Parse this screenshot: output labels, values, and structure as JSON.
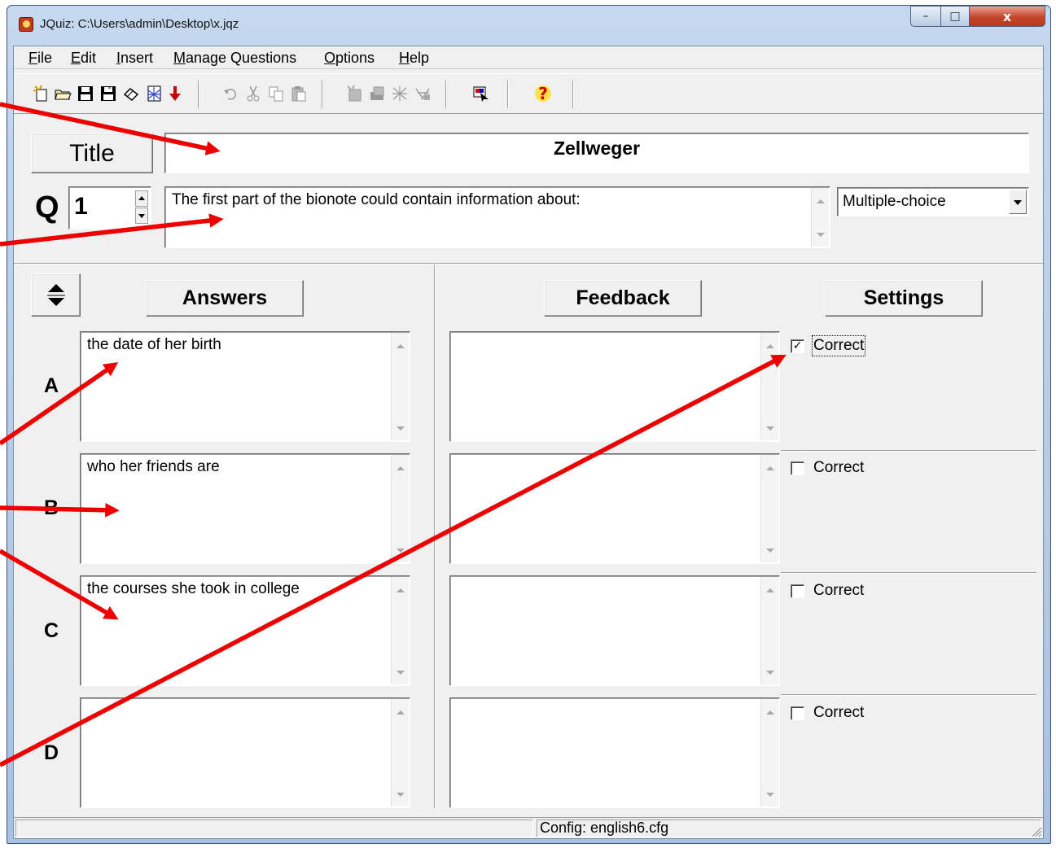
{
  "window": {
    "title": "JQuiz: C:\\Users\\admin\\Desktop\\x.jqz"
  },
  "caption_buttons": {
    "minimize": "–",
    "maximize": "□",
    "close": "x"
  },
  "menu": [
    {
      "label": "File"
    },
    {
      "label": "Edit"
    },
    {
      "label": "Insert"
    },
    {
      "label": "Manage Questions"
    },
    {
      "label": "Options"
    },
    {
      "label": "Help"
    }
  ],
  "toolbar": {
    "icons": [
      "new-file-icon",
      "open-folder-icon",
      "save-icon",
      "save-as-icon",
      "eraser-icon",
      "web-page-icon",
      "export-arrow-icon",
      "undo-icon",
      "cut-icon",
      "copy-icon",
      "paste-icon",
      "add-question-icon",
      "insert-picture-icon",
      "link-icon",
      "table-icon",
      "preview-icon",
      "help-icon"
    ],
    "help_glyph": "?"
  },
  "title_section": {
    "button_label": "Title",
    "value": "Zellweger"
  },
  "question": {
    "label": "Q",
    "number": "1",
    "text": "The first part of the bionote could contain information about:",
    "type": "Multiple-choice"
  },
  "headers": {
    "answers": "Answers",
    "feedback": "Feedback",
    "settings": "Settings"
  },
  "answers": [
    {
      "letter": "A",
      "text": "the date of her birth",
      "feedback": "",
      "correct_label": "Correct",
      "correct": true
    },
    {
      "letter": "B",
      "text": "who her friends are",
      "feedback": "",
      "correct_label": "Correct",
      "correct": false
    },
    {
      "letter": "C",
      "text": "the courses she took in college",
      "feedback": "",
      "correct_label": "Correct",
      "correct": false
    },
    {
      "letter": "D",
      "text": "",
      "feedback": "",
      "correct_label": "Correct",
      "correct": false
    }
  ],
  "status": {
    "config": "Config: english6.cfg"
  },
  "colors": {
    "annotation_arrow": "#ee0000"
  }
}
